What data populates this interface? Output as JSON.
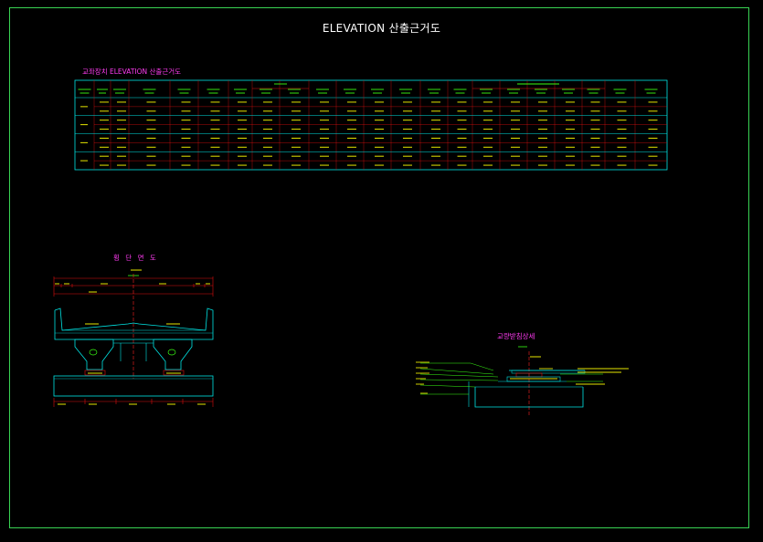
{
  "drawing": {
    "title": "ELEVATION 산출근거도",
    "table_title": "교좌장치 ELEVATION 산출근거도",
    "section_title": "횡 단 면 도",
    "detail_title": "교량받침상세"
  },
  "colors": {
    "frame": "#39d353",
    "table_lines": "#00e5e5",
    "table_red": "#e01010",
    "text_yellow": "#e6e600",
    "text_green": "#39ff14",
    "label_magenta": "#ff3cf2",
    "centerline": "#ff2020",
    "structure": "#00e5e5"
  }
}
